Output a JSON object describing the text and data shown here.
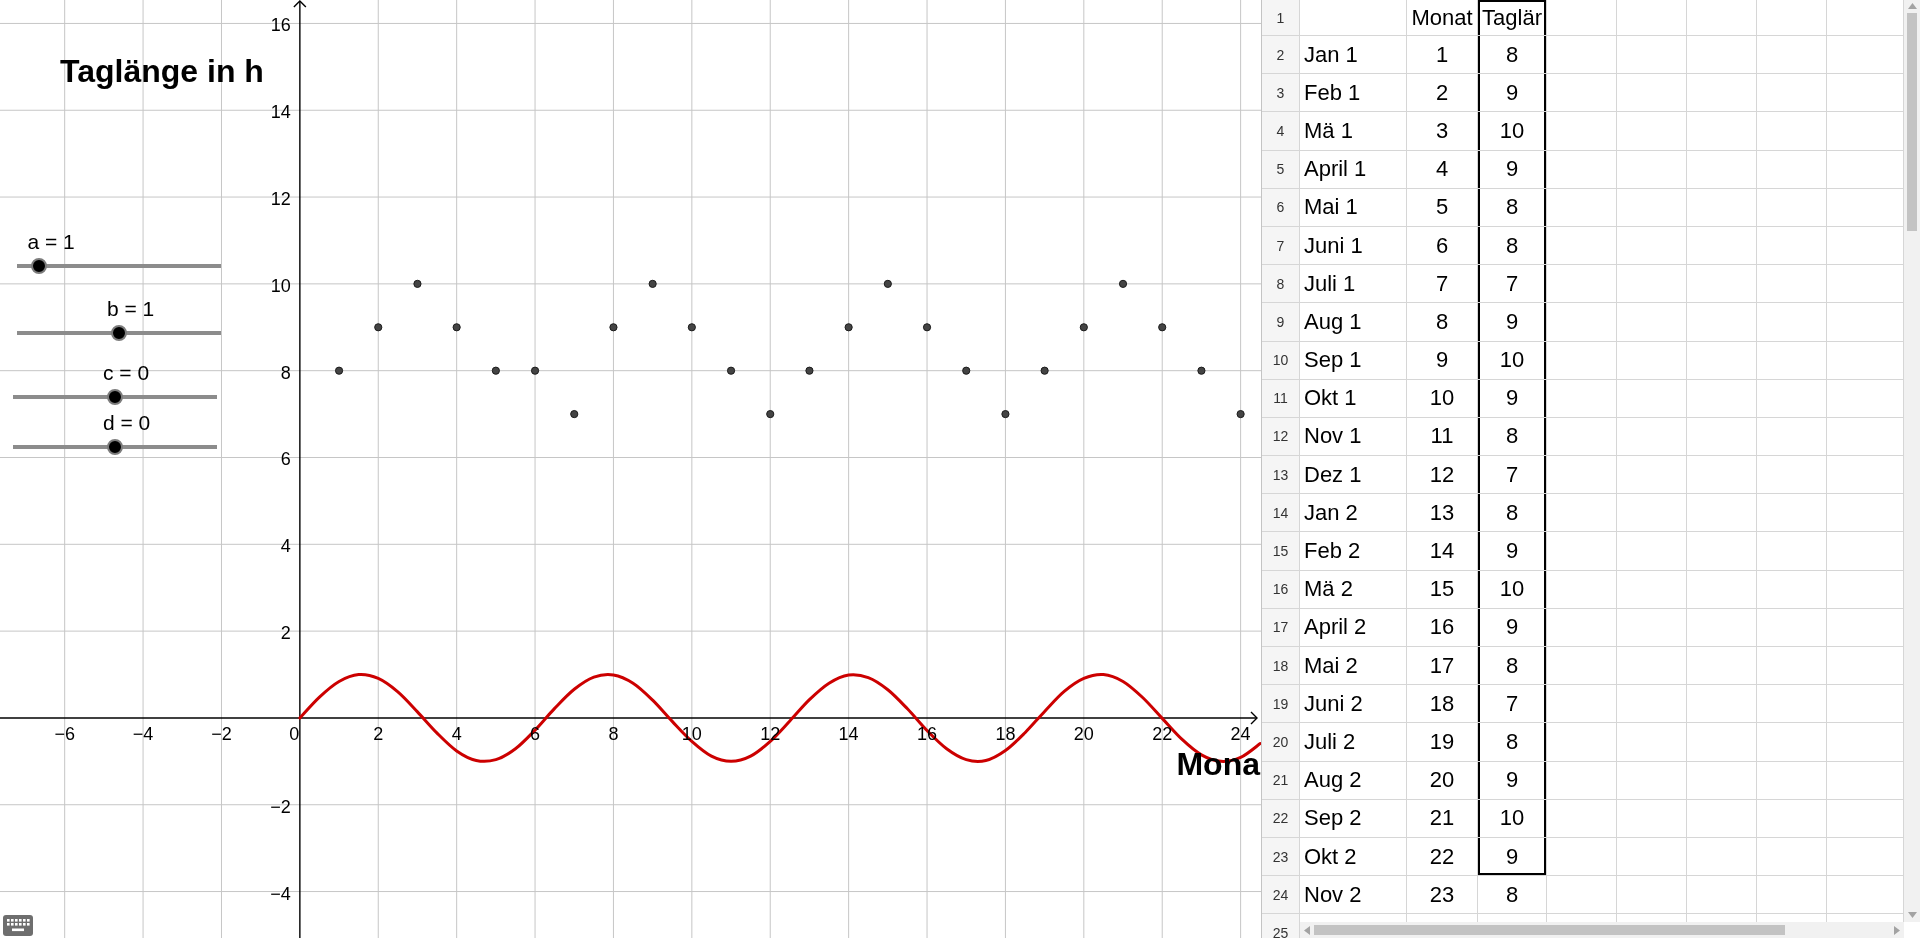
{
  "graphics": {
    "sliders": [
      {
        "label": "a = 1",
        "level": 0.11
      },
      {
        "label": "b = 1",
        "level": 0.5
      },
      {
        "label": "c = 0",
        "level": 0.5
      },
      {
        "label": "d = 0",
        "level": 0.5
      }
    ],
    "chart_data": {
      "type": "scatter",
      "xlabel": "Mona",
      "ylabel": "Taglänge in h",
      "grid": true,
      "x": [
        0,
        0.5,
        1,
        1.5,
        2,
        2.5,
        3,
        3.5,
        4,
        4.5,
        5,
        5.5,
        6,
        6.5,
        7,
        7.5,
        8,
        8.5,
        9,
        9.5,
        10,
        10.5,
        11,
        11.5,
        12,
        12.5,
        13,
        13.5,
        14,
        14.5,
        15,
        15.5,
        16,
        16.5,
        17,
        17.5,
        18,
        18.5,
        19,
        19.5,
        20,
        20.5,
        21,
        21.5,
        22,
        22.5,
        23,
        23.5,
        24,
        24.5
      ],
      "series": [
        {
          "type": "scatter",
          "color": "#444444",
          "values": [
            null,
            null,
            8,
            null,
            9,
            null,
            10,
            null,
            9,
            null,
            8,
            null,
            8,
            null,
            7,
            null,
            9,
            null,
            10,
            null,
            9,
            null,
            8,
            null,
            7,
            null,
            8,
            null,
            9,
            null,
            10,
            null,
            9,
            null,
            8,
            null,
            7,
            null,
            8,
            null,
            9,
            null,
            10,
            null,
            9,
            null,
            8,
            null,
            7,
            null
          ]
        },
        {
          "type": "line",
          "color": "#cc0000",
          "values": [
            0,
            0.48,
            0.84,
            1,
            0.91,
            0.6,
            0.14,
            -0.35,
            -0.76,
            -0.98,
            -0.96,
            -0.71,
            -0.28,
            0.22,
            0.66,
            0.94,
            0.99,
            0.8,
            0.41,
            -0.08,
            -0.54,
            -0.88,
            -1,
            -0.88,
            -0.54,
            -0.07,
            0.42,
            0.8,
            0.99,
            0.93,
            0.65,
            0.21,
            -0.29,
            -0.71,
            -0.96,
            -0.98,
            -0.75,
            -0.34,
            0.15,
            0.61,
            0.91,
            1,
            0.84,
            0.47,
            -0.01,
            -0.49,
            -0.85,
            -1,
            -0.91,
            -0.59
          ]
        }
      ],
      "xlim": [
        -7.65,
        24.52
      ],
      "ylim": [
        -5.07,
        16.54
      ],
      "xticks": [
        {
          "value": -6,
          "label": "−6"
        },
        {
          "value": -4,
          "label": "−4"
        },
        {
          "value": -2,
          "label": "−2"
        },
        0,
        2,
        4,
        6,
        8,
        10,
        12,
        14,
        16,
        18,
        20,
        22,
        24
      ],
      "yticks": [
        {
          "value": -4,
          "label": "−4"
        },
        {
          "value": -2,
          "label": "−2"
        },
        2,
        4,
        6,
        8,
        10,
        12,
        14,
        16
      ]
    }
  },
  "spreadsheet": {
    "rows": [
      {
        "number": "1",
        "cells": [
          {
            "selected": false
          },
          {
            "text": "Monat",
            "selected": false
          },
          {
            "text": "Taglär",
            "selected": true
          }
        ]
      },
      {
        "number": "2",
        "cells": [
          {
            "text": "Jan 1",
            "selected": false
          },
          {
            "text": "1",
            "selected": false
          },
          {
            "text": "8",
            "selected": true
          }
        ]
      },
      {
        "number": "3",
        "cells": [
          {
            "text": "Feb 1",
            "selected": false
          },
          {
            "text": "2",
            "selected": false
          },
          {
            "text": "9",
            "selected": true
          }
        ]
      },
      {
        "number": "4",
        "cells": [
          {
            "text": "Mä 1",
            "selected": false
          },
          {
            "text": "3",
            "selected": false
          },
          {
            "text": "10",
            "selected": true
          }
        ]
      },
      {
        "number": "5",
        "cells": [
          {
            "text": "April 1",
            "selected": false
          },
          {
            "text": "4",
            "selected": false
          },
          {
            "text": "9",
            "selected": true
          }
        ]
      },
      {
        "number": "6",
        "cells": [
          {
            "text": "Mai 1",
            "selected": false
          },
          {
            "text": "5",
            "selected": false
          },
          {
            "text": "8",
            "selected": true
          }
        ]
      },
      {
        "number": "7",
        "cells": [
          {
            "text": "Juni 1",
            "selected": false
          },
          {
            "text": "6",
            "selected": false
          },
          {
            "text": "8",
            "selected": true
          }
        ]
      },
      {
        "number": "8",
        "cells": [
          {
            "text": "Juli 1",
            "selected": false
          },
          {
            "text": "7",
            "selected": false
          },
          {
            "text": "7",
            "selected": true
          }
        ]
      },
      {
        "number": "9",
        "cells": [
          {
            "text": "Aug 1",
            "selected": false
          },
          {
            "text": "8",
            "selected": false
          },
          {
            "text": "9",
            "selected": true
          }
        ]
      },
      {
        "number": "10",
        "cells": [
          {
            "text": "Sep 1",
            "selected": false
          },
          {
            "text": "9",
            "selected": false
          },
          {
            "text": "10",
            "selected": true
          }
        ]
      },
      {
        "number": "11",
        "cells": [
          {
            "text": "Okt 1",
            "selected": false
          },
          {
            "text": "10",
            "selected": false
          },
          {
            "text": "9",
            "selected": true
          }
        ]
      },
      {
        "number": "12",
        "cells": [
          {
            "text": "Nov 1",
            "selected": false
          },
          {
            "text": "11",
            "selected": false
          },
          {
            "text": "8",
            "selected": true
          }
        ]
      },
      {
        "number": "13",
        "cells": [
          {
            "text": "Dez 1",
            "selected": false
          },
          {
            "text": "12",
            "selected": false
          },
          {
            "text": "7",
            "selected": true
          }
        ]
      },
      {
        "number": "14",
        "cells": [
          {
            "text": "Jan 2",
            "selected": false
          },
          {
            "text": "13",
            "selected": false
          },
          {
            "text": "8",
            "selected": true
          }
        ]
      },
      {
        "number": "15",
        "cells": [
          {
            "text": "Feb 2",
            "selected": false
          },
          {
            "text": "14",
            "selected": false
          },
          {
            "text": "9",
            "selected": true
          }
        ]
      },
      {
        "number": "16",
        "cells": [
          {
            "text": "Mä 2",
            "selected": false
          },
          {
            "text": "15",
            "selected": false
          },
          {
            "text": "10",
            "selected": true
          }
        ]
      },
      {
        "number": "17",
        "cells": [
          {
            "text": "April 2",
            "selected": false
          },
          {
            "text": "16",
            "selected": false
          },
          {
            "text": "9",
            "selected": true
          }
        ]
      },
      {
        "number": "18",
        "cells": [
          {
            "text": "Mai 2",
            "selected": false
          },
          {
            "text": "17",
            "selected": false
          },
          {
            "text": "8",
            "selected": true
          }
        ]
      },
      {
        "number": "19",
        "cells": [
          {
            "text": "Juni 2",
            "selected": false
          },
          {
            "text": "18",
            "selected": false
          },
          {
            "text": "7",
            "selected": true
          }
        ]
      },
      {
        "number": "20",
        "cells": [
          {
            "text": "Juli 2",
            "selected": false
          },
          {
            "text": "19",
            "selected": false
          },
          {
            "text": "8",
            "selected": true
          }
        ]
      },
      {
        "number": "21",
        "cells": [
          {
            "text": "Aug 2",
            "selected": false
          },
          {
            "text": "20",
            "selected": false
          },
          {
            "text": "9",
            "selected": true
          }
        ]
      },
      {
        "number": "22",
        "cells": [
          {
            "text": "Sep 2",
            "selected": false
          },
          {
            "text": "21",
            "selected": false
          },
          {
            "text": "10",
            "selected": true
          }
        ]
      },
      {
        "number": "23",
        "cells": [
          {
            "text": "Okt 2",
            "selected": false
          },
          {
            "text": "22",
            "selected": false
          },
          {
            "text": "9",
            "selected": true
          }
        ]
      },
      {
        "number": "24",
        "cells": [
          {
            "text": "Nov 2",
            "selected": false
          },
          {
            "text": "23",
            "selected": false
          },
          {
            "text": "8",
            "selected": false
          }
        ]
      },
      {
        "number": "25"
      }
    ]
  }
}
